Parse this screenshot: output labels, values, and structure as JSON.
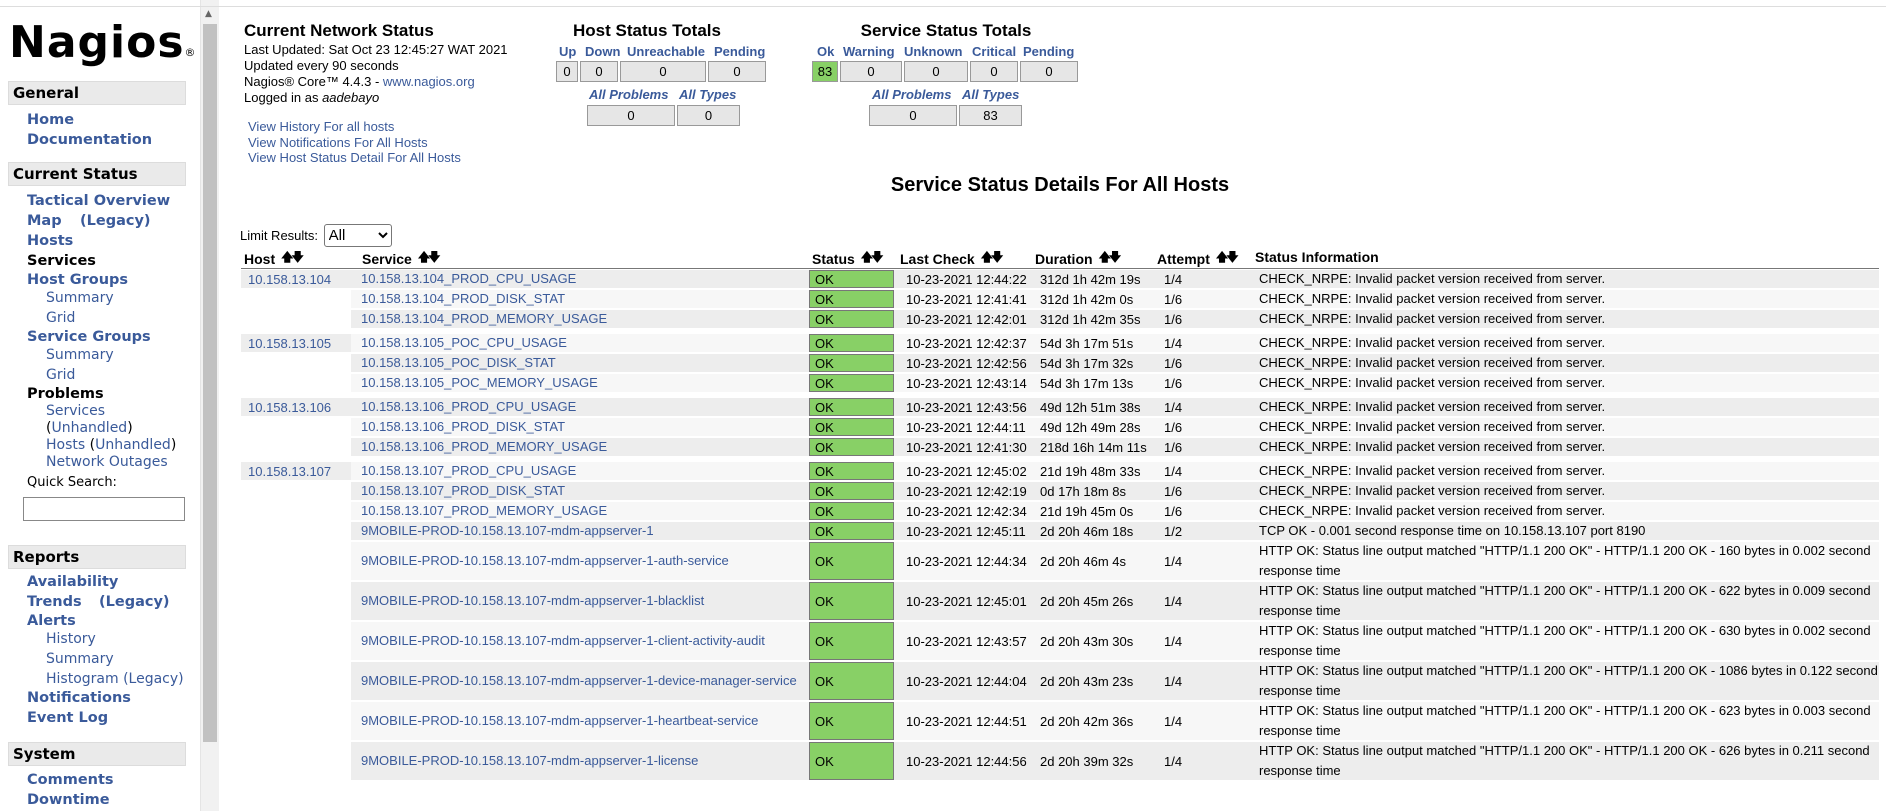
{
  "logo": {
    "text": "Nagios",
    "mark": "®"
  },
  "sidebar": {
    "general": {
      "header": "General",
      "home": "Home",
      "documentation": "Documentation"
    },
    "current_status": {
      "header": "Current Status",
      "tactical_overview": "Tactical Overview",
      "map": "Map",
      "map_legacy": "(Legacy)",
      "hosts": "Hosts",
      "services": "Services",
      "host_groups": "Host Groups",
      "hg_summary": "Summary",
      "hg_grid": "Grid",
      "service_groups": "Service Groups",
      "sg_summary": "Summary",
      "sg_grid": "Grid",
      "problems": "Problems",
      "pr_services": "Services",
      "pr_services_unhandled": "Unhandled",
      "pr_hosts": "Hosts",
      "pr_hosts_unhandled": "Unhandled",
      "network_outages": "Network Outages",
      "quick_search": "Quick Search:"
    },
    "reports": {
      "header": "Reports",
      "availability": "Availability",
      "trends": "Trends",
      "trends_legacy": "(Legacy)",
      "alerts": "Alerts",
      "history": "History",
      "summary": "Summary",
      "histogram": "Histogram (Legacy)",
      "notifications": "Notifications",
      "event_log": "Event Log"
    },
    "system": {
      "header": "System",
      "comments": "Comments",
      "downtime": "Downtime"
    }
  },
  "status_info": {
    "title": "Current Network Status",
    "last_updated": "Last Updated: Sat Oct 23 12:45:27 WAT 2021",
    "updated_every": "Updated every 90 seconds",
    "core_prefix": "Nagios® Core™ 4.4.3 - ",
    "core_link": "www.nagios.org",
    "logged_prefix": "Logged in as ",
    "user": "aadebayo",
    "links": [
      "View History For all hosts",
      "View Notifications For All Hosts",
      "View Host Status Detail For All Hosts"
    ]
  },
  "host_totals": {
    "title": "Host Status Totals",
    "headers": [
      "Up",
      "Down",
      "Unreachable",
      "Pending"
    ],
    "values": [
      "0",
      "0",
      "0",
      "0"
    ],
    "all_problems_label": "All Problems",
    "all_types_label": "All Types",
    "all_problems": "0",
    "all_types": "0"
  },
  "service_totals": {
    "title": "Service Status Totals",
    "headers": [
      "Ok",
      "Warning",
      "Unknown",
      "Critical",
      "Pending"
    ],
    "values": [
      "83",
      "0",
      "0",
      "0",
      "0"
    ],
    "all_problems_label": "All Problems",
    "all_types_label": "All Types",
    "all_problems": "0",
    "all_types": "83"
  },
  "main": {
    "title": "Service Status Details For All Hosts",
    "limit_label": "Limit Results:",
    "limit_value": "All"
  },
  "table": {
    "headers": {
      "host": "Host",
      "service": "Service",
      "status": "Status",
      "last_check": "Last Check",
      "duration": "Duration",
      "attempt": "Attempt",
      "info": "Status Information"
    },
    "rows": [
      {
        "host": "10.158.13.104",
        "service": "10.158.13.104_PROD_CPU_USAGE",
        "status": "OK",
        "last_check": "10-23-2021 12:44:22",
        "duration": "312d 1h 42m 19s",
        "attempt": "1/4",
        "info": "CHECK_NRPE: Invalid packet version received from server."
      },
      {
        "host": "",
        "service": "10.158.13.104_PROD_DISK_STAT",
        "status": "OK",
        "last_check": "10-23-2021 12:41:41",
        "duration": "312d 1h 42m 0s",
        "attempt": "1/6",
        "info": "CHECK_NRPE: Invalid packet version received from server."
      },
      {
        "host": "",
        "service": "10.158.13.104_PROD_MEMORY_USAGE",
        "status": "OK",
        "last_check": "10-23-2021 12:42:01",
        "duration": "312d 1h 42m 35s",
        "attempt": "1/6",
        "info": "CHECK_NRPE: Invalid packet version received from server."
      },
      {
        "host": "10.158.13.105",
        "service": "10.158.13.105_POC_CPU_USAGE",
        "status": "OK",
        "last_check": "10-23-2021 12:42:37",
        "duration": "54d 3h 17m 51s",
        "attempt": "1/4",
        "info": "CHECK_NRPE: Invalid packet version received from server."
      },
      {
        "host": "",
        "service": "10.158.13.105_POC_DISK_STAT",
        "status": "OK",
        "last_check": "10-23-2021 12:42:56",
        "duration": "54d 3h 17m 32s",
        "attempt": "1/6",
        "info": "CHECK_NRPE: Invalid packet version received from server."
      },
      {
        "host": "",
        "service": "10.158.13.105_POC_MEMORY_USAGE",
        "status": "OK",
        "last_check": "10-23-2021 12:43:14",
        "duration": "54d 3h 17m 13s",
        "attempt": "1/6",
        "info": "CHECK_NRPE: Invalid packet version received from server."
      },
      {
        "host": "10.158.13.106",
        "service": "10.158.13.106_PROD_CPU_USAGE",
        "status": "OK",
        "last_check": "10-23-2021 12:43:56",
        "duration": "49d 12h 51m 38s",
        "attempt": "1/4",
        "info": "CHECK_NRPE: Invalid packet version received from server."
      },
      {
        "host": "",
        "service": "10.158.13.106_PROD_DISK_STAT",
        "status": "OK",
        "last_check": "10-23-2021 12:44:11",
        "duration": "49d 12h 49m 28s",
        "attempt": "1/6",
        "info": "CHECK_NRPE: Invalid packet version received from server."
      },
      {
        "host": "",
        "service": "10.158.13.106_PROD_MEMORY_USAGE",
        "status": "OK",
        "last_check": "10-23-2021 12:41:30",
        "duration": "218d 16h 14m 11s",
        "attempt": "1/6",
        "info": "CHECK_NRPE: Invalid packet version received from server."
      },
      {
        "host": "10.158.13.107",
        "service": "10.158.13.107_PROD_CPU_USAGE",
        "status": "OK",
        "last_check": "10-23-2021 12:45:02",
        "duration": "21d 19h 48m 33s",
        "attempt": "1/4",
        "info": "CHECK_NRPE: Invalid packet version received from server."
      },
      {
        "host": "",
        "service": "10.158.13.107_PROD_DISK_STAT",
        "status": "OK",
        "last_check": "10-23-2021 12:42:19",
        "duration": "0d 17h 18m 8s",
        "attempt": "1/6",
        "info": "CHECK_NRPE: Invalid packet version received from server."
      },
      {
        "host": "",
        "service": "10.158.13.107_PROD_MEMORY_USAGE",
        "status": "OK",
        "last_check": "10-23-2021 12:42:34",
        "duration": "21d 19h 45m 0s",
        "attempt": "1/6",
        "info": "CHECK_NRPE: Invalid packet version received from server."
      },
      {
        "host": "",
        "service": "9MOBILE-PROD-10.158.13.107-mdm-appserver-1",
        "status": "OK",
        "last_check": "10-23-2021 12:45:11",
        "duration": "2d 20h 46m 18s",
        "attempt": "1/2",
        "info": "TCP OK - 0.001 second response time on 10.158.13.107 port 8190"
      },
      {
        "host": "",
        "service": "9MOBILE-PROD-10.158.13.107-mdm-appserver-1-auth-service",
        "status": "OK",
        "last_check": "10-23-2021 12:44:34",
        "duration": "2d 20h 46m 4s",
        "attempt": "1/4",
        "info": "HTTP OK: Status line output matched \"HTTP/1.1 200 OK\" - HTTP/1.1 200 OK - 160 bytes in 0.002 second response time"
      },
      {
        "host": "",
        "service": "9MOBILE-PROD-10.158.13.107-mdm-appserver-1-blacklist",
        "status": "OK",
        "last_check": "10-23-2021 12:45:01",
        "duration": "2d 20h 45m 26s",
        "attempt": "1/4",
        "info": "HTTP OK: Status line output matched \"HTTP/1.1 200 OK\" - HTTP/1.1 200 OK - 622 bytes in 0.009 second response time"
      },
      {
        "host": "",
        "service": "9MOBILE-PROD-10.158.13.107-mdm-appserver-1-client-activity-audit",
        "status": "OK",
        "last_check": "10-23-2021 12:43:57",
        "duration": "2d 20h 43m 30s",
        "attempt": "1/4",
        "info": "HTTP OK: Status line output matched \"HTTP/1.1 200 OK\" - HTTP/1.1 200 OK - 630 bytes in 0.002 second response time"
      },
      {
        "host": "",
        "service": "9MOBILE-PROD-10.158.13.107-mdm-appserver-1-device-manager-service",
        "status": "OK",
        "last_check": "10-23-2021 12:44:04",
        "duration": "2d 20h 43m 23s",
        "attempt": "1/4",
        "info": "HTTP OK: Status line output matched \"HTTP/1.1 200 OK\" - HTTP/1.1 200 OK - 1086 bytes in 0.122 second response time"
      },
      {
        "host": "",
        "service": "9MOBILE-PROD-10.158.13.107-mdm-appserver-1-heartbeat-service",
        "status": "OK",
        "last_check": "10-23-2021 12:44:51",
        "duration": "2d 20h 42m 36s",
        "attempt": "1/4",
        "info": "HTTP OK: Status line output matched \"HTTP/1.1 200 OK\" - HTTP/1.1 200 OK - 623 bytes in 0.003 second response time"
      },
      {
        "host": "",
        "service": "9MOBILE-PROD-10.158.13.107-mdm-appserver-1-license",
        "status": "OK",
        "last_check": "10-23-2021 12:44:56",
        "duration": "2d 20h 39m 32s",
        "attempt": "1/4",
        "info": "HTTP OK: Status line output matched \"HTTP/1.1 200 OK\" - HTTP/1.1 200 OK - 626 bytes in 0.211 second response time"
      }
    ]
  },
  "colors": {
    "ok": "#88d066",
    "link": "#3a5a9a",
    "header_bg": "#eaeaea"
  }
}
